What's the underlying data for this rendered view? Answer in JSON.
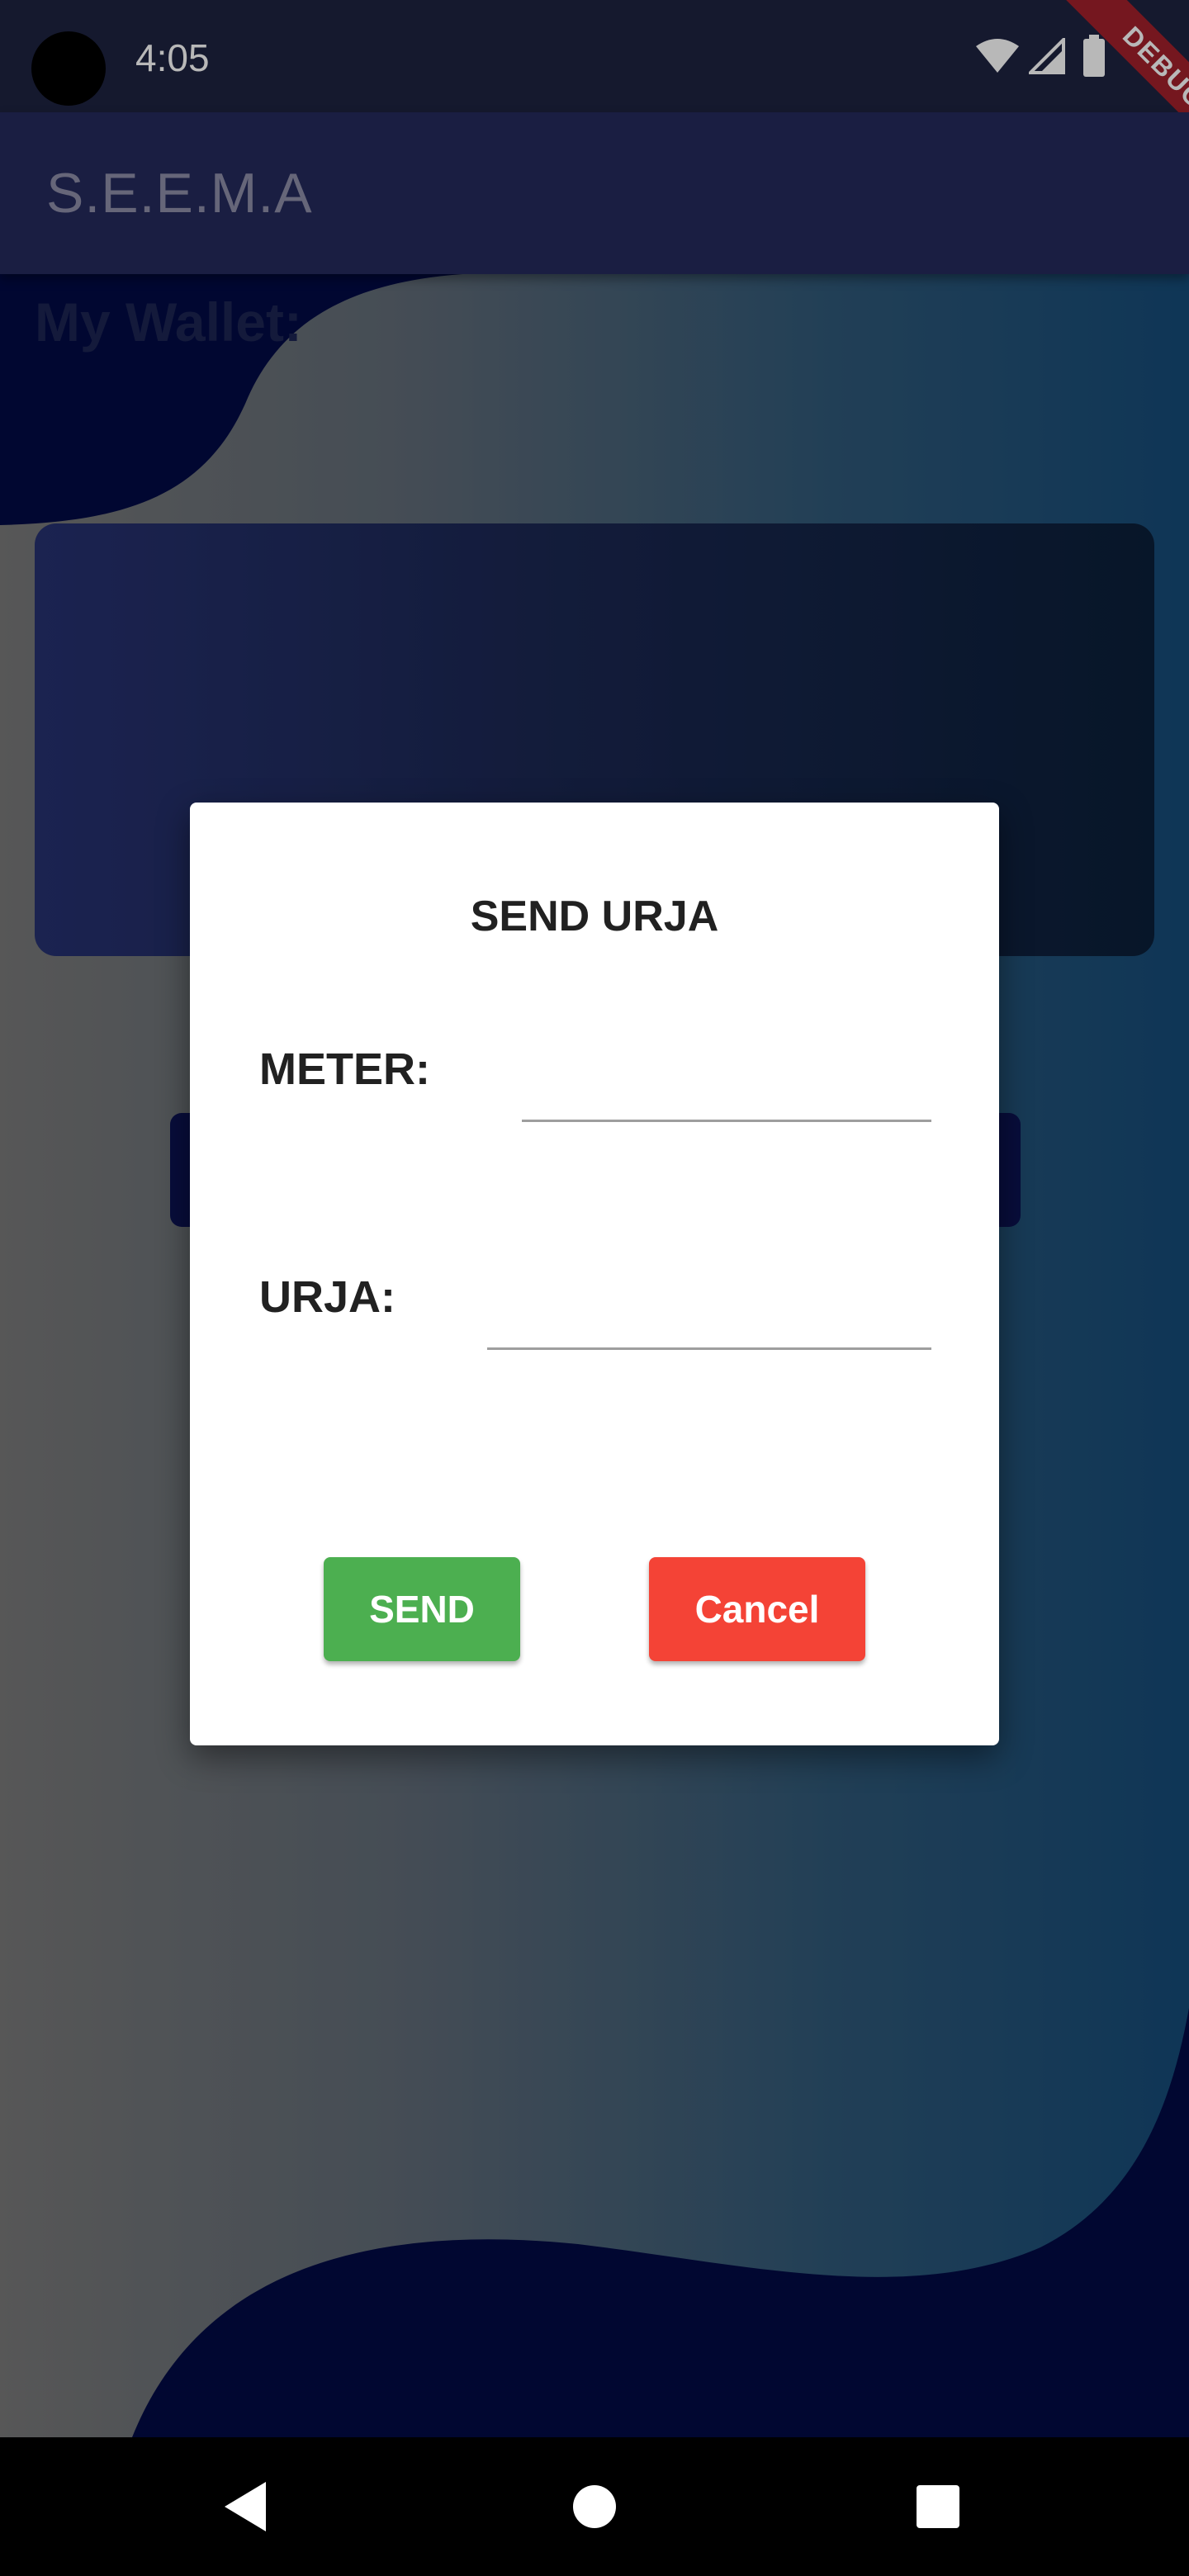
{
  "status_bar": {
    "time": "4:05",
    "icons": [
      "wifi-icon",
      "signal-icon",
      "battery-icon"
    ],
    "debug_banner": "DEBUG"
  },
  "app_bar": {
    "title": "S.E.E.M.A"
  },
  "main": {
    "wallet_title": "My Wallet:"
  },
  "dialog": {
    "title": "SEND URJA",
    "meter_label": "METER:",
    "meter_value": "",
    "urja_label": "URJA:",
    "urja_value": "",
    "send_label": "SEND",
    "cancel_label": "Cancel"
  },
  "nav_bar": {
    "icons": [
      "back-icon",
      "home-icon",
      "recents-icon"
    ]
  },
  "colors": {
    "app_bar": "#242a5c",
    "send_button": "#4caf50",
    "cancel_button": "#f44336",
    "wallet_title": "#1c2452"
  }
}
